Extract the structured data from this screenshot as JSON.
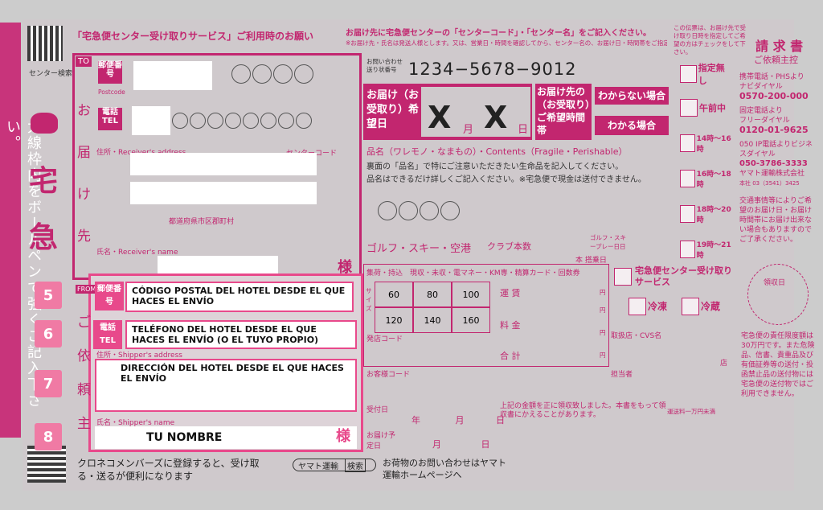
{
  "header": {
    "service_title": "「宅急便センター受け取りサービス」ご利用時のお願い",
    "center_note": "お届け先に宅急便センターの「センターコード」・「センター名」をご記入ください。",
    "center_note_sub": "※お届け先・氏名は発送人様とします。又は、営業日・時間を確認してから、センター名の、お届け日・時間帯をご指定ください。",
    "right_note": "この伝票は、お届け先で受け取り日時を指定してご希望の方はチェックをして下さい。",
    "invoice_label": "請 求 書",
    "invoice_sub": "ご依頼主控"
  },
  "left": {
    "center_search": "センター検索",
    "vertical_text": "太線枠内をボールペンで強くご記入下さい。",
    "big_char_1": "宅",
    "big_char_2": "急",
    "badges": [
      "5",
      "6",
      "7",
      "8"
    ]
  },
  "tracking": {
    "label": "お問い合わせ送り状番号",
    "number": "1234−5678−9012"
  },
  "delivery": {
    "to_label": "TO",
    "recipient_vertical": [
      "お",
      "届",
      "け",
      "先"
    ],
    "postal_label": "郵便番号",
    "postal_sub": "Postcode",
    "tel_label": "電話 TEL",
    "address_label": "住所・Receiver's address",
    "center_code_label": "センターコード",
    "prefecture_label": "都道府県市区郡町村",
    "name_label": "氏名・Receiver's name",
    "sama": "様"
  },
  "date": {
    "label": "お届け（お受取り）希望日",
    "month_value": "X",
    "month_unit": "月",
    "day_value": "X",
    "day_unit": "日",
    "time_label": "お届け先の（お受取り）ご希望時間帯",
    "unknown_btn": "わからない場合",
    "known_btn": "わかる場合"
  },
  "item": {
    "label": "品名（ワレモノ・なまもの）・Contents（Fragile・Perishable）",
    "note1": "裏面の「品名」で特にご注意いただきたい生命品を記入してください。",
    "note2": "品名はできるだけ詳しくご記入ください。※宅急便で現金は送付できません。",
    "golf": "ゴルフ・スキー・空港",
    "club": "クラブ本数",
    "book": "本",
    "golf_sub": "ゴルフ・スキープレー日日",
    "golf_date": "本 搭乗日"
  },
  "time_slots": [
    {
      "label": "指定無し"
    },
    {
      "label": "午前中"
    },
    {
      "label": "14時〜16時"
    },
    {
      "label": "16時〜18時"
    },
    {
      "label": "18時〜20時"
    },
    {
      "label": "19時〜21時"
    }
  ],
  "contact": {
    "mobile": "携帯電話・PHSより",
    "navi": "ナビダイヤル",
    "navi_number": "0570-200-000",
    "fixed": "固定電話より",
    "free": "フリーダイヤル",
    "free_number": "0120-01-9625",
    "ip": "050 IP電話よりビジネスダイヤル",
    "ip_number": "050-3786-3333",
    "company": "ヤマト運輸株式会社",
    "hq": "本社 03（3541）3425",
    "traffic": "交通事情等によりご希望のお届け日・お届け時間帯にお届け出来ない場合もありますのでご了承ください。",
    "stamp": "領収日",
    "liability": "宅急便の責任限度額は30万円です。また危険品、信書、貴重品及び有価証券等の送付・投函禁止品の送付物には宅急便の送付物ではご利用できません。"
  },
  "price_table": {
    "header": "集荷・持込　現収・未収・電マネー・KM専・精算カード・回数券",
    "size_label": "サイズ",
    "sizes": [
      "60",
      "80",
      "100",
      "120",
      "140",
      "160"
    ],
    "fare": "運 賃",
    "charge": "料 金",
    "total": "合 計",
    "yen": "円",
    "shop_code": "発店コード",
    "customer_code": "お客様コード",
    "shop_label": "取扱店・CVS名",
    "shop_suffix": "店",
    "staff": "担当者",
    "center_service": "宅急便センター受け取りサービス",
    "cool": "冷凍",
    "fridge": "冷蔵"
  },
  "sender": {
    "from_label": "FROM",
    "sender_vertical": [
      "ご",
      "依",
      "頼",
      "主"
    ],
    "postal_tag": "郵便番号",
    "postal_text": "CÓDIGO POSTAL DEL HOTEL DESDE EL QUE HACES EL ENVÍO",
    "tel_tag": "電話 TEL",
    "tel_text": "TELÉFONO DEL HOTEL DESDE EL QUE HACES EL ENVÍO (O EL TUYO PROPIO)",
    "address_label": "住所・Shipper's address",
    "address_text": "DIRECCIÓN DEL HOTEL DESDE EL QUE HACES EL ENVÍO",
    "name_label": "氏名・Shipper's name",
    "name_text": "TU NOMBRE",
    "sama": "様"
  },
  "bottom": {
    "receipt": "上記の金額を正に領収致しました。本書をもって領収書にかえることがあります。",
    "fare_note": "運送料一万円未満",
    "accept_date": "受付日",
    "year": "年",
    "month": "月",
    "day": "日",
    "delivery_date": "お届け予定日",
    "member": "クロネコメンバーズに登録すると、受け取る・送るが便利になります",
    "yamato_search": "ヤマト運輸",
    "search_btn": "検索",
    "inquiry": "お荷物のお問い合わせはヤマト運輸ホームページへ"
  },
  "colors": {
    "magenta": "#c2266f",
    "highlight": "#e8498b",
    "badge": "#f07aa4"
  }
}
